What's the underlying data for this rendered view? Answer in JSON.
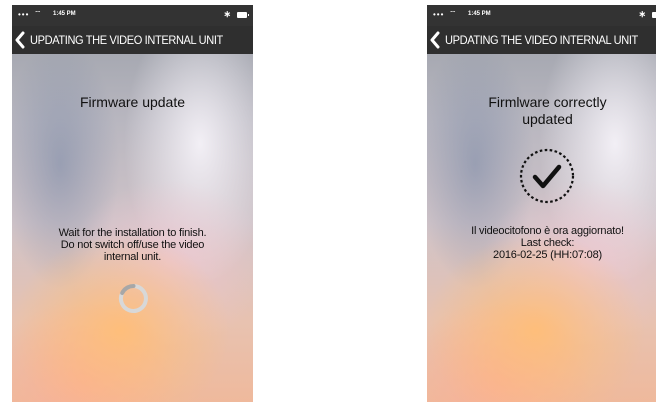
{
  "status_bar": {
    "signal": "•••",
    "wifi": "⌔",
    "time": "1:45 PM",
    "bluetooth": "∗"
  },
  "header": {
    "title": "UPDATING THE VIDEO INTERNAL UNIT",
    "back_icon": "chevron-left-icon"
  },
  "screens": [
    {
      "title": "Firmware update",
      "message": [
        "Wait for the installation to finish.",
        "Do not switch off/use the video",
        "internal unit."
      ],
      "indicator": "spinner-icon"
    },
    {
      "title": [
        "Firmlware correctly",
        "updated"
      ],
      "message": [
        "Il videocitofono è ora aggiornato!",
        "Last check:",
        "2016-02-25 (HH:07:08)"
      ],
      "indicator": "checkmark-circle-icon"
    }
  ],
  "colors": {
    "bar": "#2f2f2f",
    "text": "#111111",
    "spinner": "#d5d5d5"
  }
}
